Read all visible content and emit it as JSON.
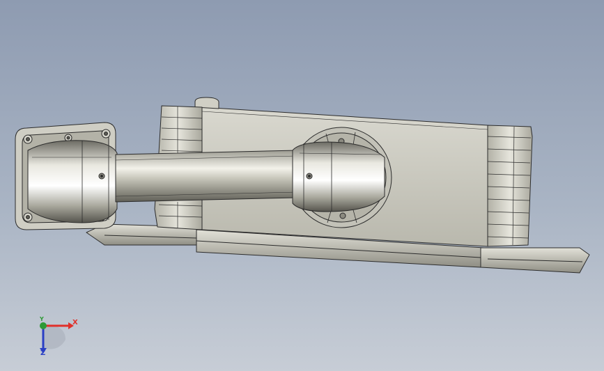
{
  "viewport": {
    "background_top": "#8e9bb1",
    "background_bottom": "#c7cdd6",
    "model_color": "#c9c8bd",
    "edge_color": "#2b2b2b"
  },
  "triad": {
    "x_label": "X",
    "y_label": "Y",
    "z_label": "Z",
    "x_color": "#e0302a",
    "y_color": "#2e9a36",
    "z_color": "#2a3fc4"
  }
}
